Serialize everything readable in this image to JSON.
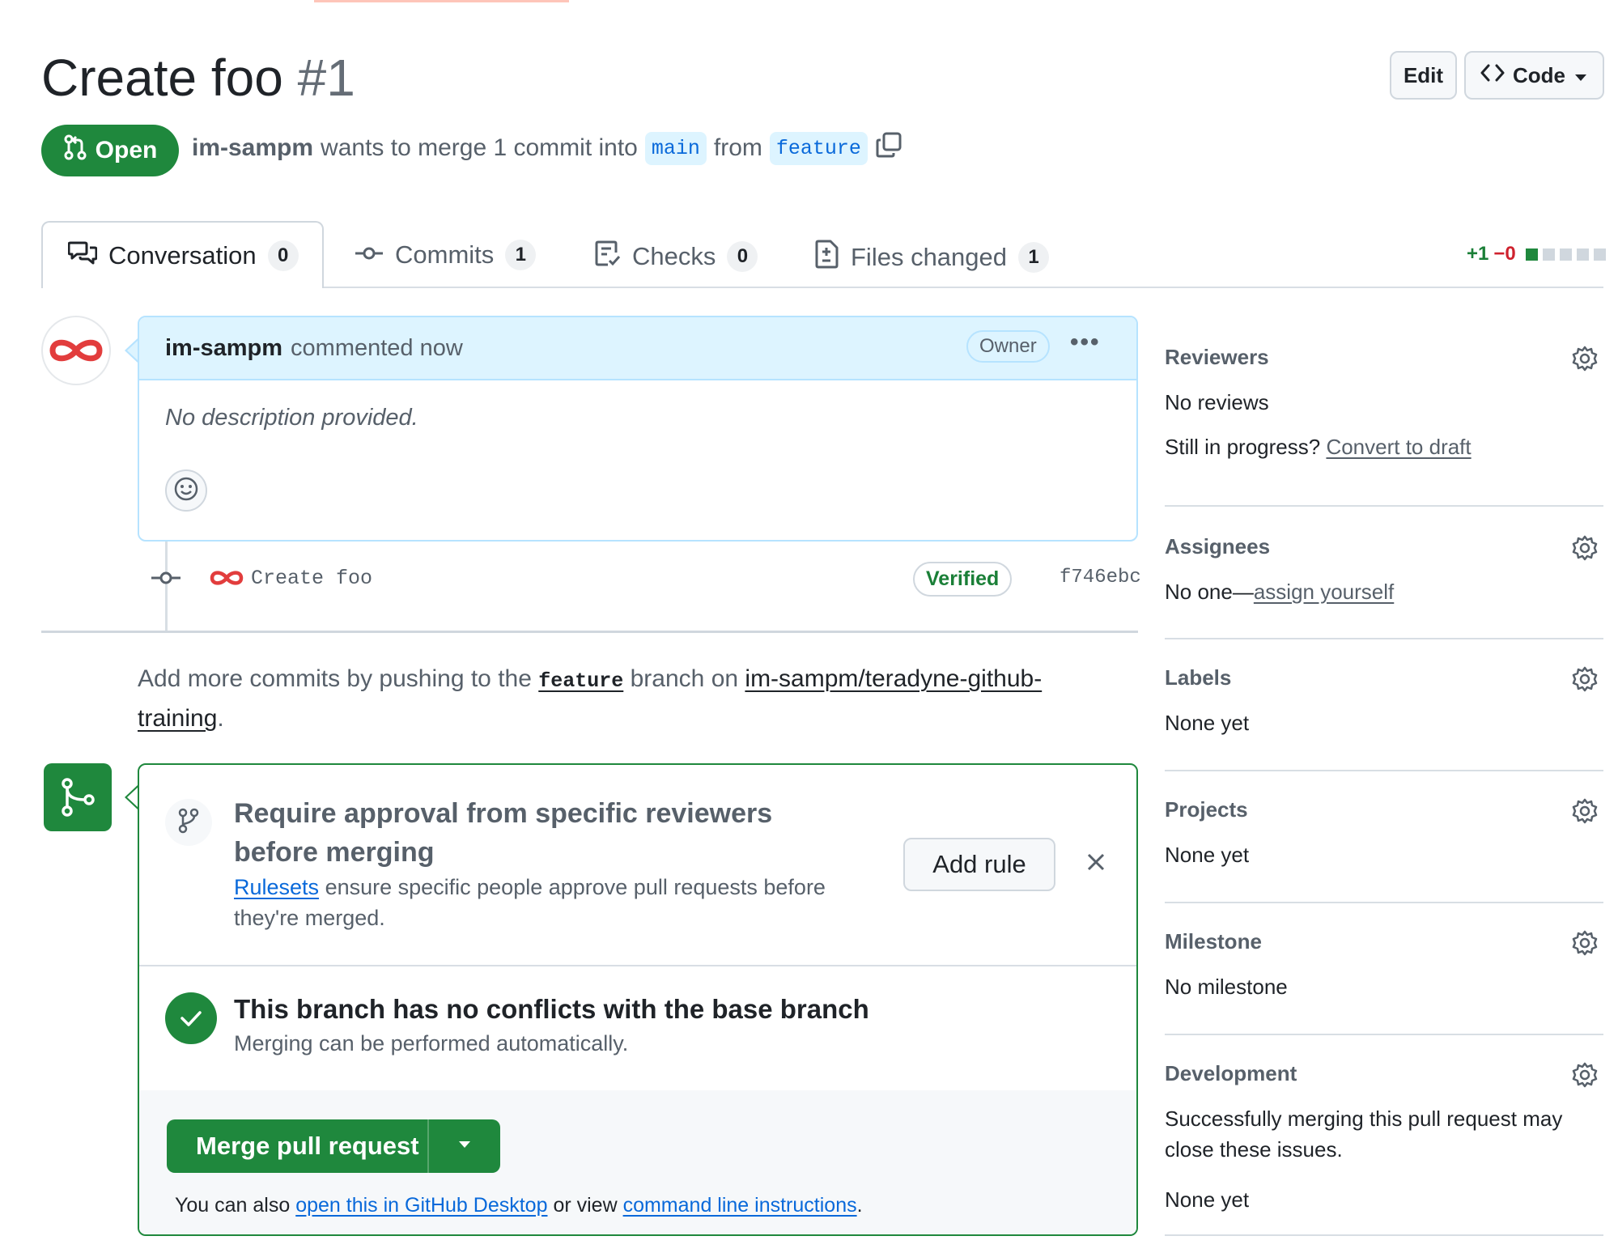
{
  "header": {
    "title": "Create foo",
    "number": "#1",
    "edit_label": "Edit",
    "code_label": "Code",
    "state_label": "Open",
    "author": "im-sampm",
    "merge_text": "wants to merge 1 commit into",
    "base_branch": "main",
    "from_text": "from",
    "head_branch": "feature"
  },
  "tabs": [
    {
      "label": "Conversation",
      "count": "0",
      "icon": "comment-discussion-icon"
    },
    {
      "label": "Commits",
      "count": "1",
      "icon": "git-commit-icon"
    },
    {
      "label": "Checks",
      "count": "0",
      "icon": "checklist-icon"
    },
    {
      "label": "Files changed",
      "count": "1",
      "icon": "file-diff-icon"
    }
  ],
  "diffstat": {
    "additions": "+1",
    "deletions": "−0"
  },
  "comment": {
    "author": "im-sampm",
    "action": "commented now",
    "role_badge": "Owner",
    "body": "No description provided."
  },
  "commit": {
    "message": "Create foo",
    "badge": "Verified",
    "sha": "f746ebc"
  },
  "push_note": {
    "prefix": "Add more commits by pushing to the",
    "branch": "feature",
    "middle": "branch on",
    "repo": "im-sampm/teradyne-github-training",
    "suffix": "."
  },
  "merge_box": {
    "rule_title": "Require approval from specific reviewers before merging",
    "rule_link": "Rulesets",
    "rule_desc": "ensure specific people approve pull requests before they're merged.",
    "add_rule_label": "Add rule",
    "status_title": "This branch has no conflicts with the base branch",
    "status_desc": "Merging can be performed automatically.",
    "merge_label": "Merge pull request",
    "note_prefix": "You can also",
    "note_link1": "open this in GitHub Desktop",
    "note_mid": "or view",
    "note_link2": "command line instructions",
    "note_suffix": "."
  },
  "sidebar": {
    "reviewers": {
      "title": "Reviewers",
      "value": "No reviews",
      "progress_text": "Still in progress?",
      "draft_link": "Convert to draft"
    },
    "assignees": {
      "title": "Assignees",
      "value": "No one—",
      "assign_link": "assign yourself"
    },
    "labels": {
      "title": "Labels",
      "value": "None yet"
    },
    "projects": {
      "title": "Projects",
      "value": "None yet"
    },
    "milestone": {
      "title": "Milestone",
      "value": "No milestone"
    },
    "development": {
      "title": "Development",
      "desc": "Successfully merging this pull request may close these issues.",
      "value": "None yet"
    }
  },
  "colors": {
    "open_green": "#1f883d",
    "link_blue": "#0969da",
    "comment_blue": "#ddf4ff",
    "deletion_red": "#cf222e"
  }
}
